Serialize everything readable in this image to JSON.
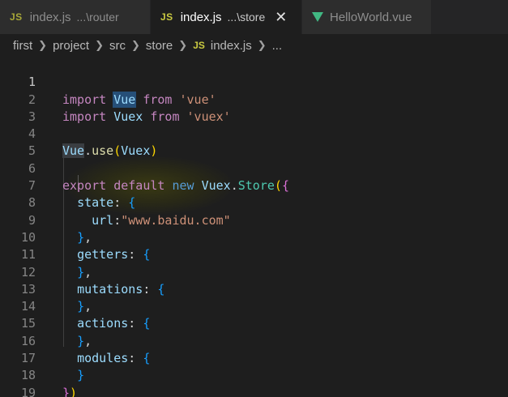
{
  "tabs": [
    {
      "icon": "JS",
      "name": "index.js",
      "path": "...\\router",
      "active": false
    },
    {
      "icon": "JS",
      "name": "index.js",
      "path": "...\\store",
      "active": true,
      "close": "✕"
    },
    {
      "icon": "vue",
      "name": "HelloWorld.vue",
      "path": "",
      "active": false
    }
  ],
  "breadcrumb": {
    "items": [
      "first",
      "project",
      "src",
      "store"
    ],
    "file_icon": "JS",
    "file": "index.js",
    "more": "..."
  },
  "editor": {
    "line_numbers": [
      "1",
      "2",
      "3",
      "4",
      "5",
      "6",
      "7",
      "8",
      "9",
      "10",
      "11",
      "12",
      "13",
      "14",
      "15",
      "16",
      "17",
      "18",
      "19"
    ],
    "code": {
      "l1": {
        "import": "import",
        "name": "Vue",
        "from": "from",
        "src": "'vue'"
      },
      "l2": {
        "import": "import",
        "name": "Vuex",
        "from": "from",
        "src": "'vuex'"
      },
      "l4": {
        "obj": "Vue",
        "method": "use",
        "arg": "Vuex"
      },
      "l6": {
        "export": "export",
        "default": "default",
        "new": "new",
        "obj": "Vuex",
        "cls": "Store"
      },
      "l7": {
        "key": "state"
      },
      "l8": {
        "key": "url",
        "value": "\"www.baidu.com\""
      },
      "l10": {
        "key": "getters"
      },
      "l12": {
        "key": "mutations"
      },
      "l14": {
        "key": "actions"
      },
      "l16": {
        "key": "modules"
      }
    }
  },
  "colors": {
    "background": "#1e1e1e",
    "tabbar": "#252526",
    "keyword": "#c586c0",
    "string": "#ce9178",
    "class": "#4ec9b0",
    "property": "#9cdcfe",
    "function": "#dcdcaa"
  }
}
